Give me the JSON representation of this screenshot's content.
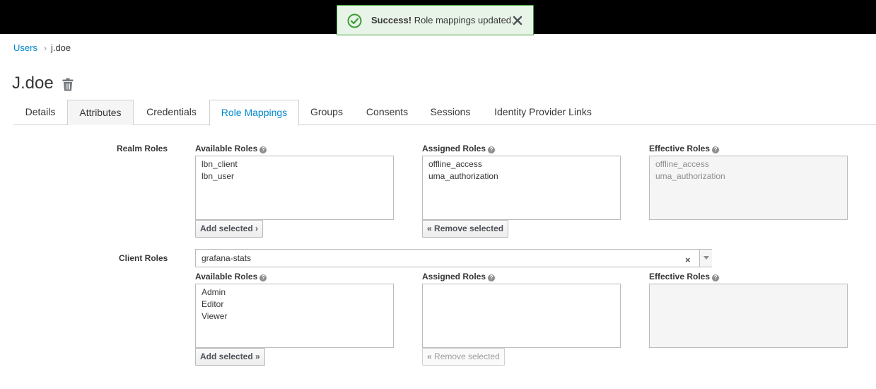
{
  "notification": {
    "status": "Success!",
    "message": "Role mappings updated."
  },
  "breadcrumb": {
    "parent": "Users",
    "separator": "›",
    "current": "j.doe"
  },
  "page": {
    "title": "J.doe"
  },
  "tabs": [
    {
      "label": "Details"
    },
    {
      "label": "Attributes"
    },
    {
      "label": "Credentials"
    },
    {
      "label": "Role Mappings",
      "active": true
    },
    {
      "label": "Groups"
    },
    {
      "label": "Consents"
    },
    {
      "label": "Sessions"
    },
    {
      "label": "Identity Provider Links"
    }
  ],
  "realm_roles": {
    "label": "Realm Roles",
    "available_label": "Available Roles",
    "assigned_label": "Assigned Roles",
    "effective_label": "Effective Roles",
    "available": [
      "lbn_client",
      "lbn_user"
    ],
    "assigned": [
      "offline_access",
      "uma_authorization"
    ],
    "effective": [
      "offline_access",
      "uma_authorization"
    ],
    "add_button": "Add selected",
    "add_chevron": "›",
    "remove_button": "Remove selected",
    "remove_chevron": "«"
  },
  "client_roles": {
    "label": "Client Roles",
    "selected_client": "grafana-stats",
    "clear_symbol": "×",
    "available_label": "Available Roles",
    "assigned_label": "Assigned Roles",
    "effective_label": "Effective Roles",
    "available": [
      "Admin",
      "Editor",
      "Viewer"
    ],
    "assigned": [],
    "effective": [],
    "add_button": "Add selected",
    "add_chevron": "»",
    "remove_button": "Remove selected",
    "remove_chevron": "«"
  },
  "help_glyph": "?",
  "colors": {
    "accent": "#0088ce",
    "success_border": "#3f9c35",
    "success_bg": "#e9f4e9",
    "topbar": "#000000"
  },
  "icons": {
    "notification": "check-circle-icon",
    "dismiss": "close-icon",
    "delete_user": "trash-icon",
    "help": "question-circle-icon",
    "dropdown": "caret-down-icon"
  }
}
